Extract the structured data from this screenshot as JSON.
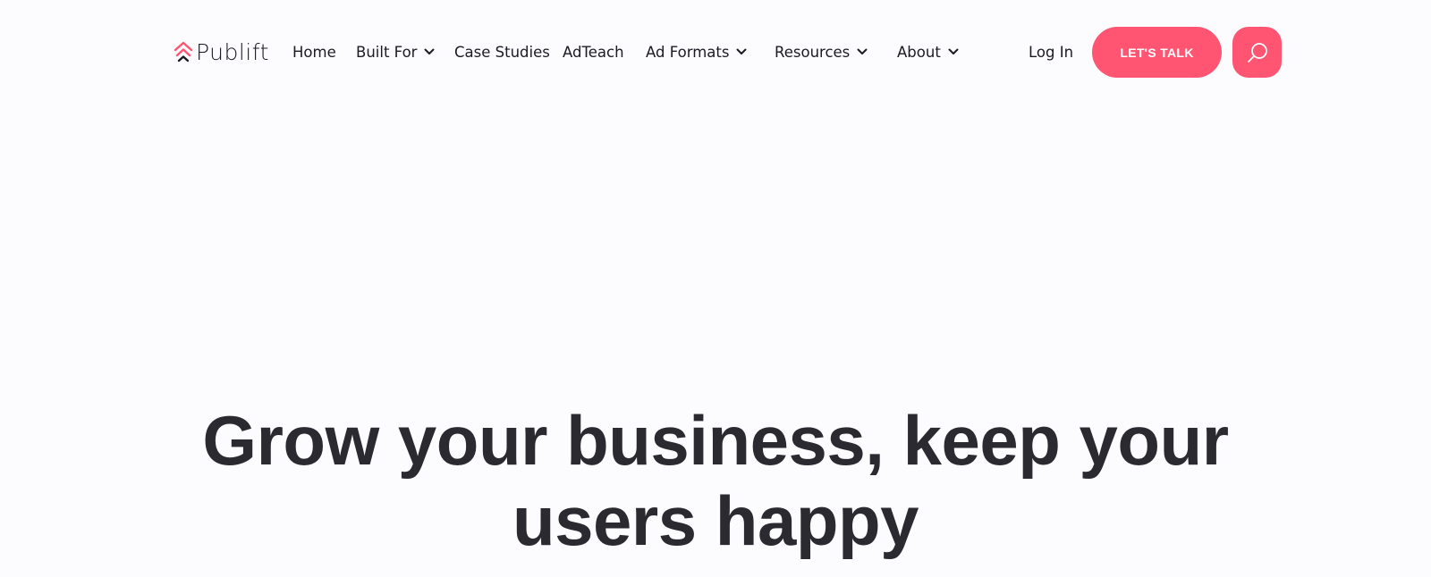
{
  "header": {
    "logo_text": "Publift",
    "nav": [
      {
        "label": "Home",
        "has_dropdown": false
      },
      {
        "label": "Built For",
        "has_dropdown": true
      },
      {
        "label": "Case Studies",
        "has_dropdown": false
      },
      {
        "label": "AdTeach",
        "has_dropdown": false
      },
      {
        "label": "Ad Formats",
        "has_dropdown": true
      },
      {
        "label": "Resources",
        "has_dropdown": true
      },
      {
        "label": "About",
        "has_dropdown": true
      }
    ],
    "login_label": "Log In",
    "cta_label": "LET'S TALK",
    "search_icon": "search-icon"
  },
  "hero": {
    "title_line1": "Grow your business, keep your",
    "title_line2": "users happy"
  },
  "colors": {
    "accent": "#ff5573",
    "background": "#fcfbfd",
    "text": "#1c1b22",
    "heading": "#2a2a30"
  }
}
